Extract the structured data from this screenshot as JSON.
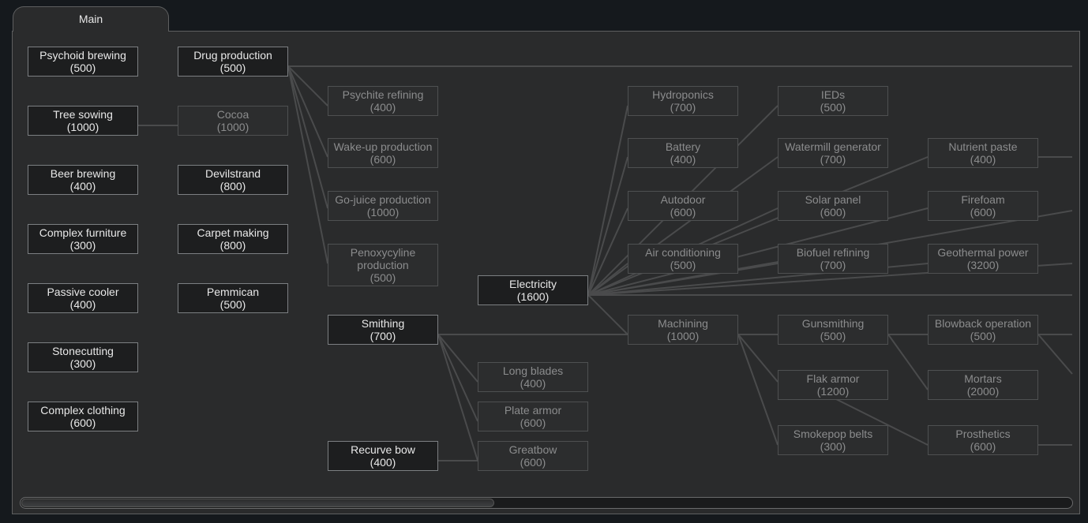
{
  "tabs": [
    {
      "label": "Main"
    }
  ],
  "nodes": {
    "psychoid_brewing": {
      "name": "Psychoid brewing",
      "cost": "(500)"
    },
    "tree_sowing": {
      "name": "Tree sowing",
      "cost": "(1000)"
    },
    "beer_brewing": {
      "name": "Beer brewing",
      "cost": "(400)"
    },
    "complex_furniture": {
      "name": "Complex furniture",
      "cost": "(300)"
    },
    "passive_cooler": {
      "name": "Passive cooler",
      "cost": "(400)"
    },
    "stonecutting": {
      "name": "Stonecutting",
      "cost": "(300)"
    },
    "complex_clothing": {
      "name": "Complex clothing",
      "cost": "(600)"
    },
    "drug_production": {
      "name": "Drug production",
      "cost": "(500)"
    },
    "cocoa": {
      "name": "Cocoa",
      "cost": "(1000)"
    },
    "devilstrand": {
      "name": "Devilstrand",
      "cost": "(800)"
    },
    "carpet_making": {
      "name": "Carpet making",
      "cost": "(800)"
    },
    "pemmican": {
      "name": "Pemmican",
      "cost": "(500)"
    },
    "psychite_refining": {
      "name": "Psychite refining",
      "cost": "(400)"
    },
    "wakeup_production": {
      "name": "Wake-up production",
      "cost": "(600)"
    },
    "gojuice_production": {
      "name": "Go-juice production",
      "cost": "(1000)"
    },
    "penoxycyline_production": {
      "name": "Penoxycyline production",
      "cost": "(500)"
    },
    "smithing": {
      "name": "Smithing",
      "cost": "(700)"
    },
    "recurve_bow": {
      "name": "Recurve bow",
      "cost": "(400)"
    },
    "electricity": {
      "name": "Electricity",
      "cost": "(1600)"
    },
    "long_blades": {
      "name": "Long blades",
      "cost": "(400)"
    },
    "plate_armor": {
      "name": "Plate armor",
      "cost": "(600)"
    },
    "greatbow": {
      "name": "Greatbow",
      "cost": "(600)"
    },
    "hydroponics": {
      "name": "Hydroponics",
      "cost": "(700)"
    },
    "battery": {
      "name": "Battery",
      "cost": "(400)"
    },
    "autodoor": {
      "name": "Autodoor",
      "cost": "(600)"
    },
    "air_conditioning": {
      "name": "Air conditioning",
      "cost": "(500)"
    },
    "machining": {
      "name": "Machining",
      "cost": "(1000)"
    },
    "ieds": {
      "name": "IEDs",
      "cost": "(500)"
    },
    "watermill_generator": {
      "name": "Watermill generator",
      "cost": "(700)"
    },
    "solar_panel": {
      "name": "Solar panel",
      "cost": "(600)"
    },
    "biofuel_refining": {
      "name": "Biofuel refining",
      "cost": "(700)"
    },
    "gunsmithing": {
      "name": "Gunsmithing",
      "cost": "(500)"
    },
    "flak_armor": {
      "name": "Flak armor",
      "cost": "(1200)"
    },
    "smokepop_belts": {
      "name": "Smokepop belts",
      "cost": "(300)"
    },
    "nutrient_paste": {
      "name": "Nutrient paste",
      "cost": "(400)"
    },
    "firefoam": {
      "name": "Firefoam",
      "cost": "(600)"
    },
    "geothermal_power": {
      "name": "Geothermal power",
      "cost": "(3200)"
    },
    "blowback_operation": {
      "name": "Blowback operation",
      "cost": "(500)"
    },
    "mortars": {
      "name": "Mortars",
      "cost": "(2000)"
    },
    "prosthetics": {
      "name": "Prosthetics",
      "cost": "(600)"
    }
  },
  "scroll": {
    "position_fraction": 0.0,
    "visible_fraction": 0.45
  }
}
